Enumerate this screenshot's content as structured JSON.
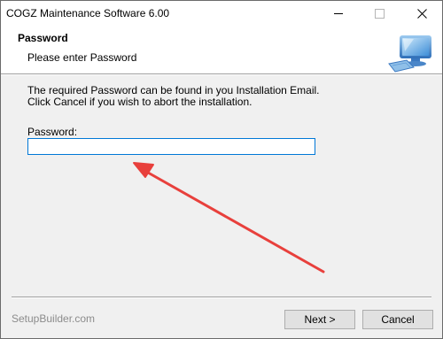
{
  "window": {
    "title": "COGZ Maintenance Software 6.00",
    "controls": [
      "minimize",
      "maximize",
      "close"
    ]
  },
  "header": {
    "title": "Password",
    "subtitle": "Please enter Password",
    "graphic_icon": "computer-monitor-icon"
  },
  "body": {
    "info_line1": "The required Password can be found in you Installation Email.",
    "info_line2": "Click Cancel if you wish to abort the installation.",
    "password_label": "Password:",
    "password_value": "",
    "annotation": "red-arrow-pointing-to-password-field"
  },
  "footer": {
    "brand": "SetupBuilder.com",
    "next_label": "Next >",
    "cancel_label": "Cancel"
  },
  "colors": {
    "accent": "#0078d7",
    "annotation_red": "#e8403c"
  }
}
